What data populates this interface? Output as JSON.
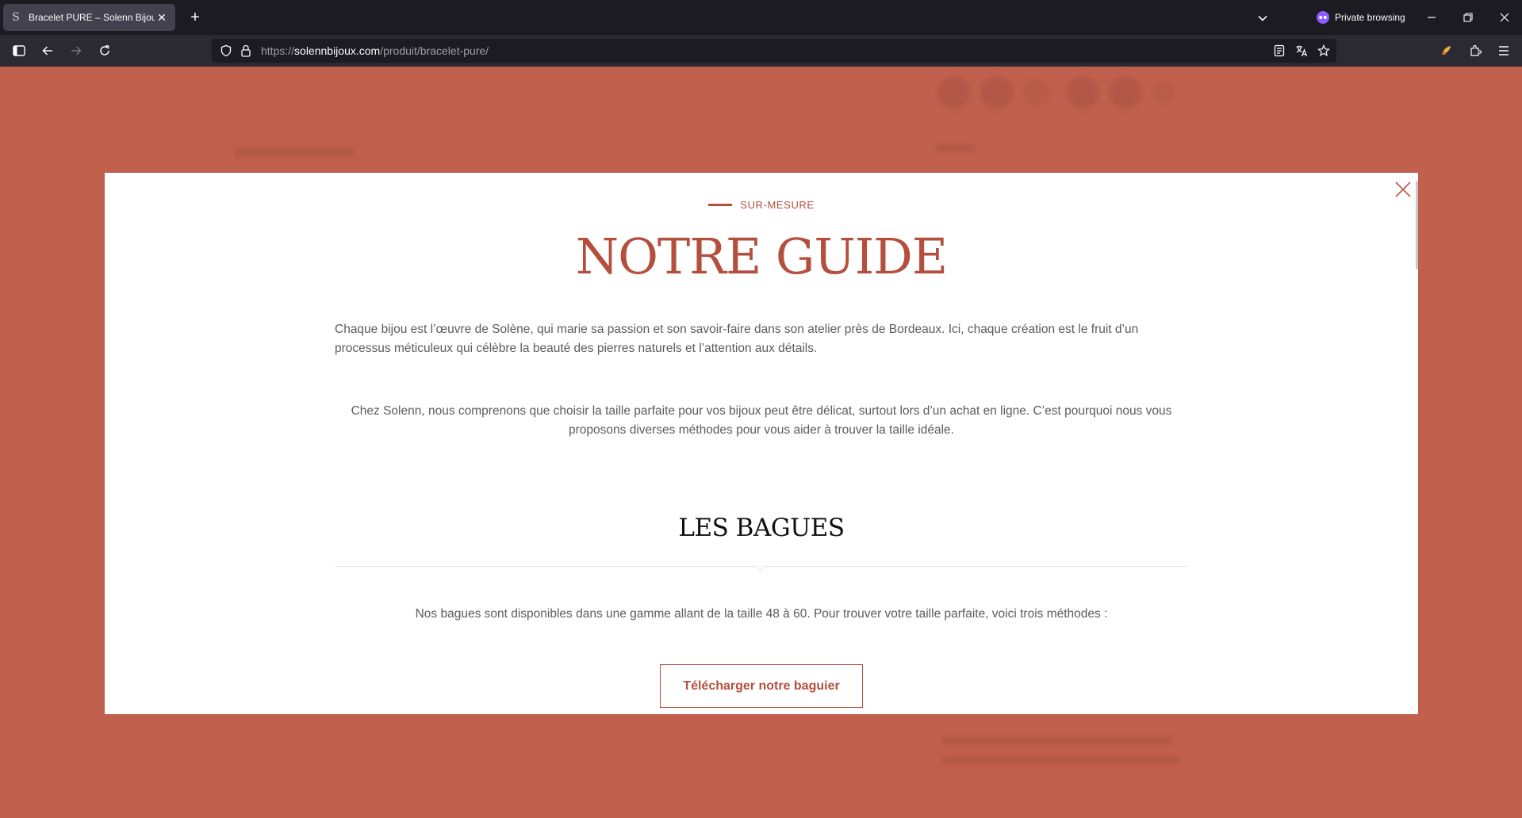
{
  "browser": {
    "tab_title": "Bracelet PURE – Solenn Bijoux",
    "tab_favicon": "S",
    "private_label": "Private browsing",
    "url_prefix": "https://",
    "url_host": "solennbijoux.com",
    "url_path": "/produit/bracelet-pure/",
    "icons": [
      "sidebar-icon",
      "back-icon",
      "forward-icon",
      "reload-icon",
      "shield-icon",
      "lock-icon",
      "reader-view-icon",
      "translate-icon",
      "bookmark-star-icon",
      "extension-icon",
      "menu-icon",
      "minimize-icon",
      "restore-icon",
      "close-icon"
    ]
  },
  "modal": {
    "eyebrow": "SUR-MESURE",
    "title": "NOTRE GUIDE",
    "intro": "Chaque bijou est l’œuvre de Solène, qui marie sa passion et son savoir-faire dans son atelier près de Bordeaux. Ici, chaque création est le fruit d’un processus méticuleux qui célèbre la beauté des pierres naturels et l’attention aux détails.",
    "sizing_text": "Chez Solenn, nous comprenons que choisir la taille parfaite pour vos bijoux peut être délicat, surtout lors d’un achat en ligne. C’est pourquoi nous vous proposons diverses méthodes pour vous aider à trouver la taille idéale.",
    "section_title": "LES BAGUES",
    "rings_text": "Nos bagues sont disponibles dans une gamme allant de la taille 48 à 60. Pour trouver votre taille parfaite, voici trois méthodes :",
    "cta_label": "Télécharger notre baguier",
    "accent_color": "#b54f3d"
  }
}
